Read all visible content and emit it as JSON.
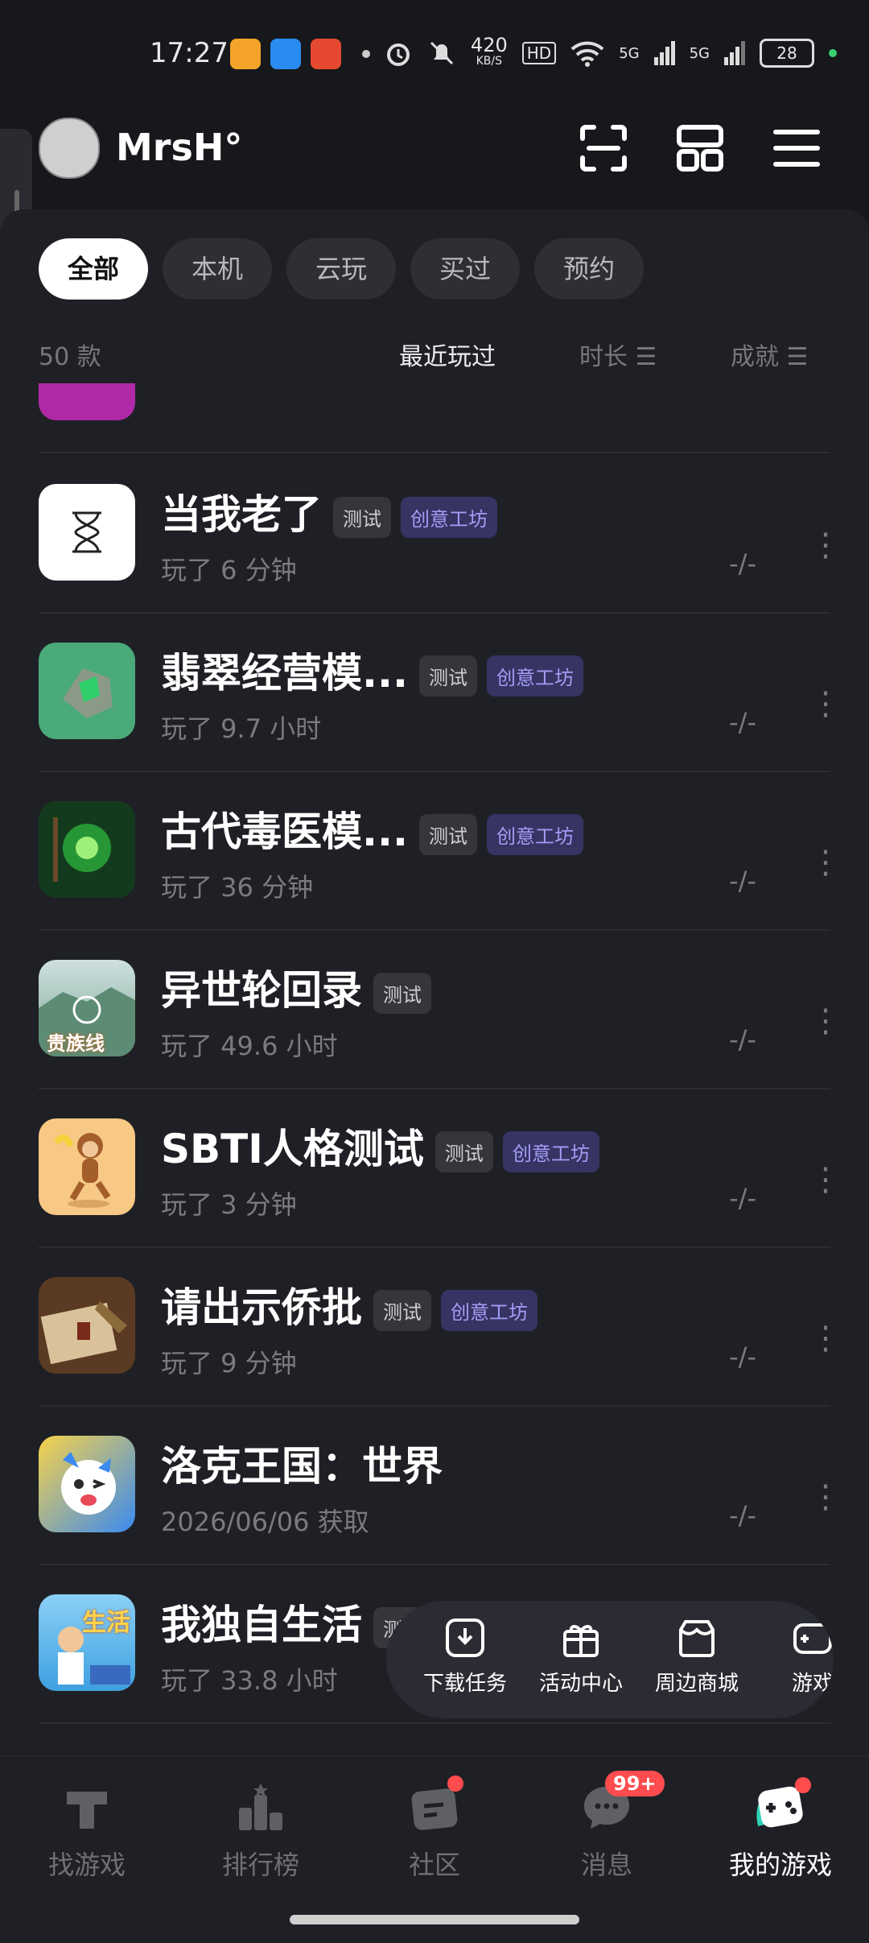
{
  "status_bar": {
    "time": "17:27",
    "net_speed": "420",
    "net_unit": "KB/S",
    "hd": "HD",
    "sig1": "5G",
    "sig2": "5G",
    "battery": "28"
  },
  "header": {
    "username": "MrsH°"
  },
  "tabs": [
    "全部",
    "本机",
    "云玩",
    "买过",
    "预约"
  ],
  "sortbar": {
    "count": "50 款",
    "recent": "最近玩过",
    "duration": "时长 ☰",
    "achievement": "成就 ☰"
  },
  "games": [
    {
      "title": "当我老了",
      "badges": [
        "测试",
        "创意工坊"
      ],
      "sub": "玩了 6 分钟",
      "value": "-/-",
      "icon": "hourglass-icon",
      "color": "#ffffff"
    },
    {
      "title": "翡翠经营模...",
      "badges": [
        "测试",
        "创意工坊"
      ],
      "sub": "玩了 9.7 小时",
      "value": "-/-",
      "icon": "jade-icon",
      "color": "#4aaa7a"
    },
    {
      "title": "古代毒医模...",
      "badges": [
        "测试",
        "创意工坊"
      ],
      "sub": "玩了 36 分钟",
      "value": "-/-",
      "icon": "poison-icon",
      "color": "#143a1e"
    },
    {
      "title": "异世轮回录",
      "badges": [
        "测试"
      ],
      "sub": "玩了 49.6 小时",
      "value": "-/-",
      "icon": "landscape-icon",
      "color": "#8fb6a7",
      "icon_text": "贵族线"
    },
    {
      "title": "SBTI人格测试",
      "badges": [
        "测试",
        "创意工坊"
      ],
      "sub": "玩了 3 分钟",
      "value": "-/-",
      "icon": "monkey-icon",
      "color": "#f8c885"
    },
    {
      "title": "请出示侨批",
      "badges": [
        "测试",
        "创意工坊"
      ],
      "sub": "玩了 9 分钟",
      "value": "-/-",
      "icon": "letter-icon",
      "color": "#5a3a22"
    },
    {
      "title": "洛克王国：世界",
      "badges": [],
      "sub": "2026/06/06 获取",
      "value": "-/-",
      "icon": "roco-icon",
      "color": "#3a8af0"
    },
    {
      "title": "我独自生活",
      "badges": [
        "测试"
      ],
      "sub": "玩了 33.8 小时",
      "value": "",
      "icon": "life-icon",
      "color": "#6cc0f0",
      "icon_text": "生活"
    }
  ],
  "fab": [
    "下载任务",
    "活动中心",
    "周边商城",
    "游戏"
  ],
  "bottom_nav": [
    "找游戏",
    "排行榜",
    "社区",
    "消息",
    "我的游戏"
  ],
  "message_badge": "99+"
}
